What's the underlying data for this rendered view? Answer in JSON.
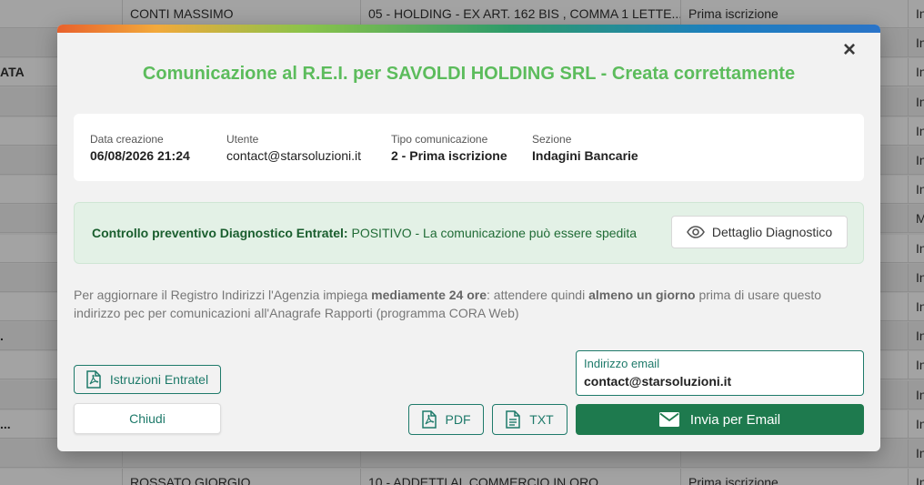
{
  "background_table": {
    "rows": [
      {
        "c0": "",
        "c1": "CONTI MASSIMO",
        "c2": "05 - HOLDING - EX ART. 162 BIS , COMMA 1 LETTE...",
        "c3": "Prima iscrizione",
        "c4": "In"
      },
      {
        "c0": "",
        "c1": "",
        "c2": "",
        "c3": "",
        "c4": "In"
      },
      {
        "c0": "ATA",
        "c1": "",
        "c2": "",
        "c3": "",
        "c4": "In"
      },
      {
        "c0": "",
        "c1": "",
        "c2": "",
        "c3": "",
        "c4": "In"
      },
      {
        "c0": "",
        "c1": "",
        "c2": "",
        "c3": "",
        "c4": "In"
      },
      {
        "c0": "",
        "c1": "",
        "c2": "",
        "c3": "",
        "c4": "In"
      },
      {
        "c0": "",
        "c1": "",
        "c2": "",
        "c3": "",
        "c4": "In"
      },
      {
        "c0": "",
        "c1": "",
        "c2": "",
        "c3": "",
        "c4": "M"
      },
      {
        "c0": "",
        "c1": "",
        "c2": "",
        "c3": "",
        "c4": "In"
      },
      {
        "c0": "",
        "c1": "",
        "c2": "",
        "c3": "",
        "c4": "In"
      },
      {
        "c0": "",
        "c1": "",
        "c2": "",
        "c3": "",
        "c4": "In"
      },
      {
        "c0": ".",
        "c1": "",
        "c2": "",
        "c3": "",
        "c4": "In"
      },
      {
        "c0": "",
        "c1": "",
        "c2": "",
        "c3": "",
        "c4": "In"
      },
      {
        "c0": "",
        "c1": "",
        "c2": "",
        "c3": "",
        "c4": "In"
      },
      {
        "c0": "...",
        "c1": "",
        "c2": "",
        "c3": "",
        "c4": "In"
      },
      {
        "c0": "",
        "c1": "",
        "c2": "",
        "c3": "",
        "c4": "In"
      },
      {
        "c0": "",
        "c1": "ROSSATO GIORGIO",
        "c2": "10 - ADDETTI AL COMMERCIO IN ORO",
        "c3": "Prima iscrizione",
        "c4": "In"
      }
    ]
  },
  "modal": {
    "title": "Comunicazione al R.E.I. per SAVOLDI HOLDING SRL - Creata correttamente",
    "close_label": "×",
    "info": {
      "data_creazione_label": "Data creazione",
      "data_creazione_value": "06/08/2026 21:24",
      "utente_label": "Utente",
      "utente_value": "contact@starsoluzioni.it",
      "tipo_label": "Tipo comunicazione",
      "tipo_value": "2 - Prima iscrizione",
      "sezione_label": "Sezione",
      "sezione_value": "Indagini Bancarie"
    },
    "diagnostic": {
      "label": "Controllo preventivo Diagnostico Entratel:",
      "result": " POSITIVO - La comunicazione può essere spedita",
      "detail_button": "Dettaglio Diagnostico"
    },
    "note": {
      "part1": "Per aggiornare il Registro Indirizzi l'Agenzia impiega ",
      "bold1": "mediamente 24 ore",
      "part2": ": attendere quindi ",
      "bold2": "almeno un giorno",
      "part3": " prima di usare questo indirizzo pec per comunicazioni all'Anagrafe Rapporti (programma CORA Web)"
    },
    "buttons": {
      "istruzioni": "Istruzioni Entratel",
      "chiudi": "Chiudi",
      "pdf": "PDF",
      "txt": "TXT",
      "send": "Invia per Email"
    },
    "email": {
      "label": "Indirizzo email",
      "value": "contact@starsoluzioni.it"
    },
    "colors": {
      "title": "#5cbc5c",
      "accent": "#1e7a6a",
      "send": "#1e7a4e",
      "diag_bg": "#e3f1e6"
    },
    "icons": {
      "close": "close-icon",
      "eye": "eye-icon",
      "pdf": "pdf-file-icon",
      "txt": "txt-file-icon",
      "envelope": "envelope-icon"
    }
  }
}
